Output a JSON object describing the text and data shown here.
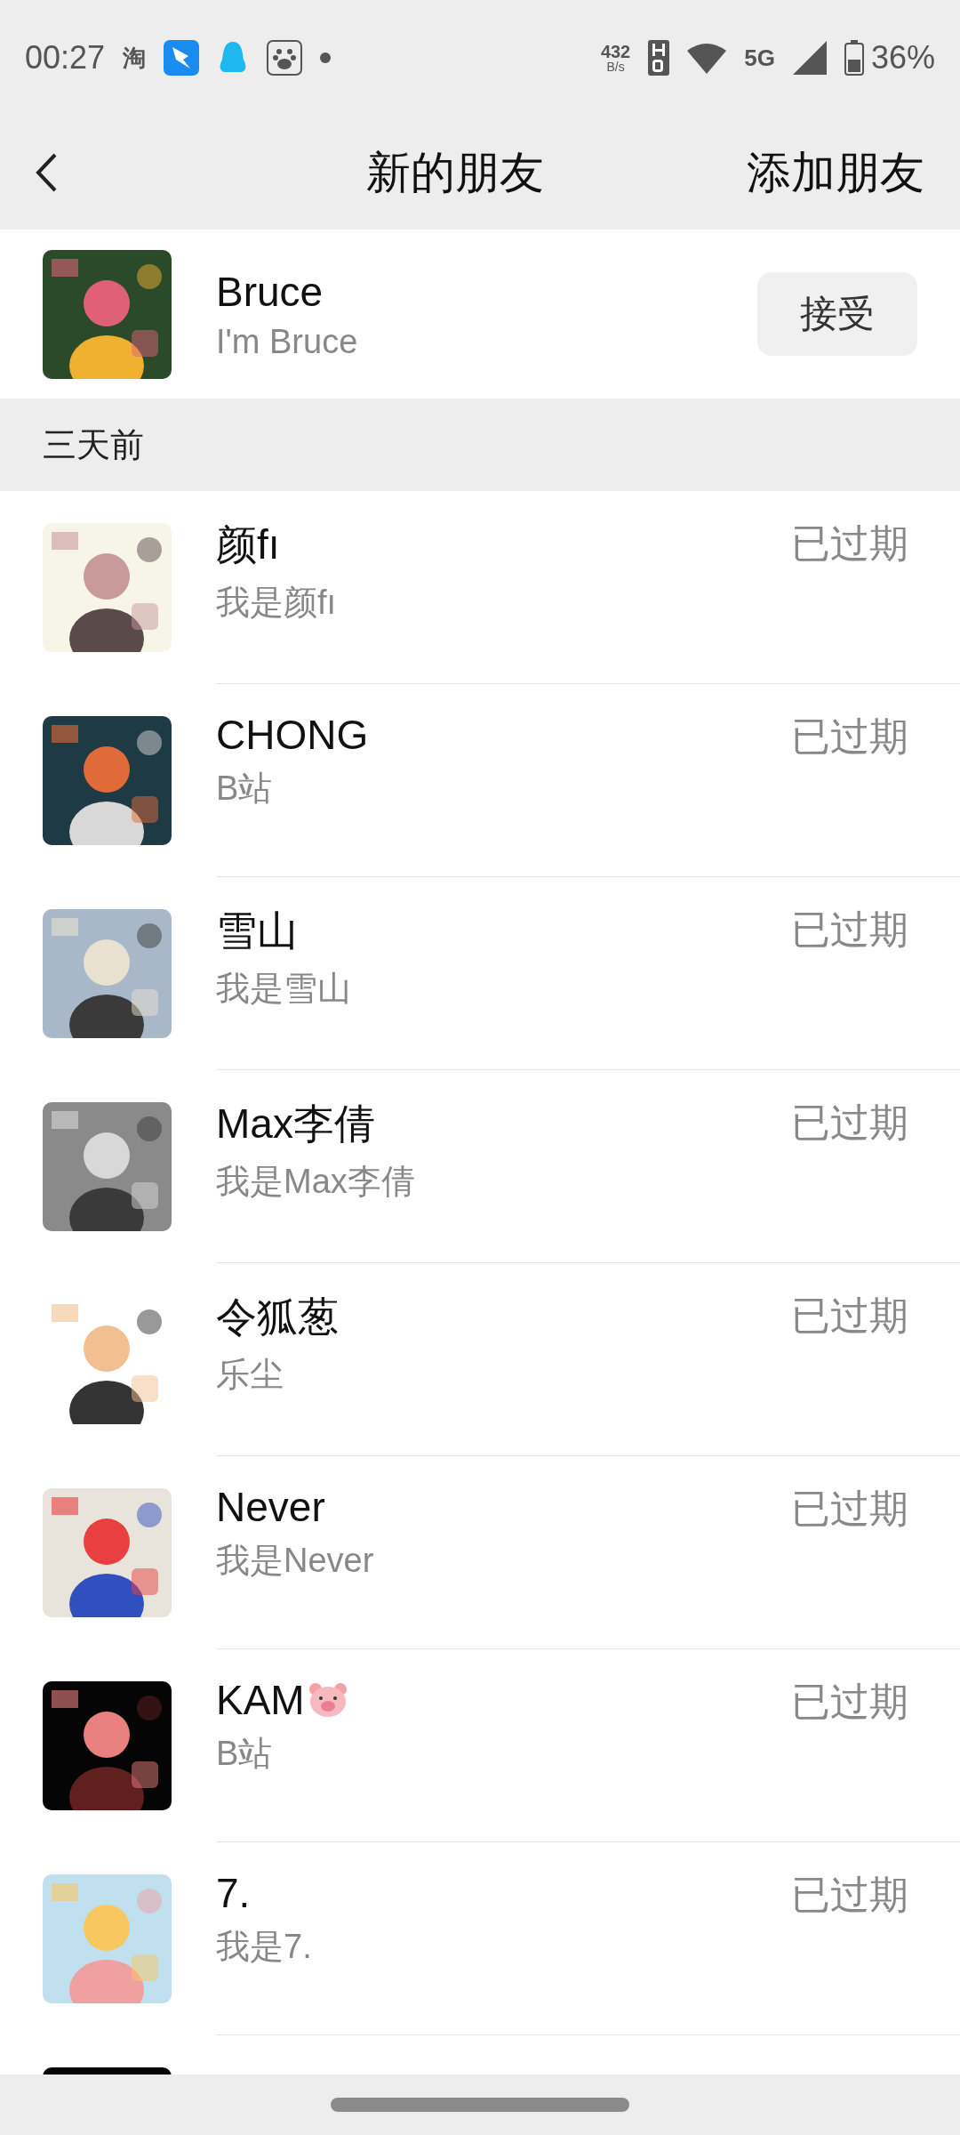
{
  "status_bar": {
    "time": "00:27",
    "app_label": "淘",
    "speed_value": "432",
    "speed_unit": "B/s",
    "network": "5G",
    "battery": "36%"
  },
  "nav": {
    "title": "新的朋友",
    "action": "添加朋友"
  },
  "pending": {
    "name": "Bruce",
    "message": "I'm Bruce",
    "button": "接受"
  },
  "section": "三天前",
  "requests": [
    {
      "name": "颜fı",
      "message": "我是颜fı",
      "status": "已过期"
    },
    {
      "name": "CHONG",
      "message": "B站",
      "status": "已过期"
    },
    {
      "name": "雪山",
      "message": "我是雪山",
      "status": "已过期"
    },
    {
      "name": "Max李倩",
      "message": "我是Max李倩",
      "status": "已过期"
    },
    {
      "name": "令狐葱",
      "message": "乐尘",
      "status": "已过期"
    },
    {
      "name": "Never",
      "message": "我是Never",
      "status": "已过期"
    },
    {
      "name": "KAM",
      "message": "B站",
      "status": "已过期",
      "pig": true
    },
    {
      "name": "7.",
      "message": "我是7.",
      "status": "已过期"
    }
  ]
}
